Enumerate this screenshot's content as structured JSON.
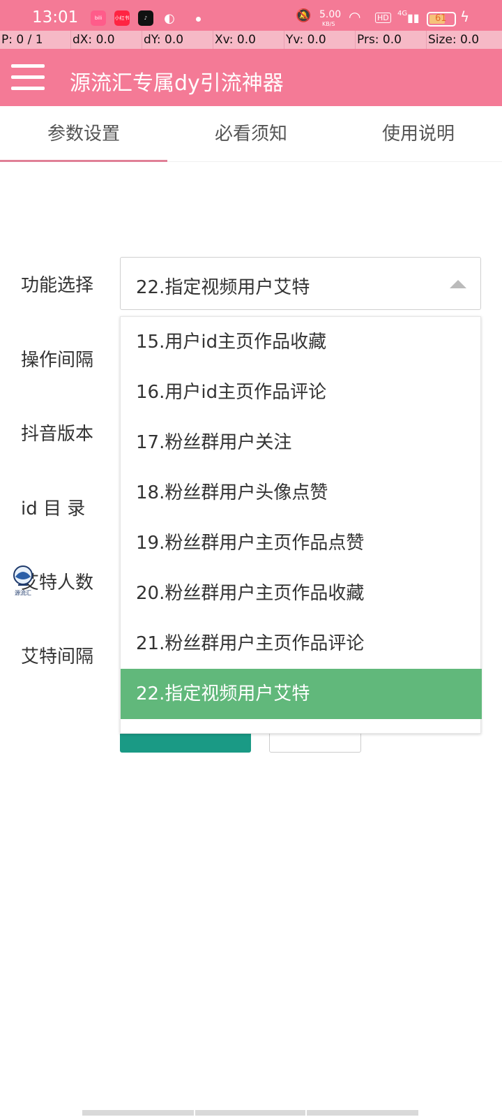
{
  "status_bar": {
    "time": "13:01",
    "app_icons": [
      "bilibili-icon",
      "xiaohongshu-icon",
      "tiktok-icon",
      "wechat-icon"
    ],
    "network_speed": "5.00",
    "network_unit": "KB/S",
    "hd_label": "HD",
    "signal_label": "4G",
    "battery_level": "61"
  },
  "debug_bar": [
    "P: 0 / 1",
    "dX: 0.0",
    "dY: 0.0",
    "Xv: 0.0",
    "Yv: 0.0",
    "Prs: 0.0",
    "Size: 0.0"
  ],
  "app_bar": {
    "title": "源流汇专属dy引流神器"
  },
  "tabs": [
    {
      "label": "参数设置",
      "active": true
    },
    {
      "label": "必看须知",
      "active": false
    },
    {
      "label": "使用说明",
      "active": false
    }
  ],
  "form": {
    "labels": {
      "function": "功能选择",
      "interval": "操作间隔",
      "version": "抖音版本",
      "id_dir": "id 目 录",
      "mention_count": "艾特人数",
      "mention_interval": "艾特间隔"
    },
    "function_select_value": "22.指定视频用户艾特"
  },
  "dropdown": {
    "options": [
      "15.用户id主页作品收藏",
      "16.用户id主页作品评论",
      "17.粉丝群用户关注",
      "18.粉丝群用户头像点赞",
      "19.粉丝群用户主页作品点赞",
      "20.粉丝群用户主页作品收藏",
      "21.粉丝群用户主页作品评论",
      "22.指定视频用户艾特"
    ],
    "selected_index": 7
  },
  "colors": {
    "brand_pink": "#f47a96",
    "selected_green": "#61b87b",
    "save_button": "#1a9a85"
  }
}
